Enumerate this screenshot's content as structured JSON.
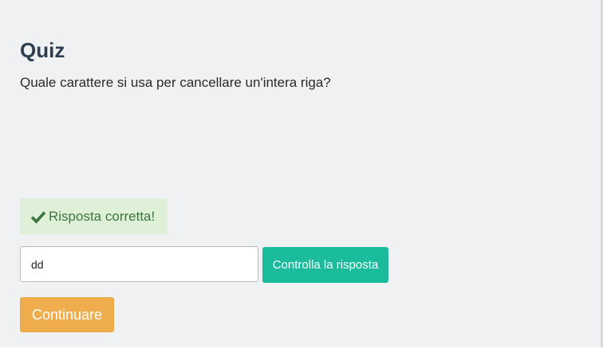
{
  "quiz": {
    "title": "Quiz",
    "question": "Quale carattere si usa per cancellare un'intera riga?"
  },
  "feedback": {
    "icon": "check-icon",
    "text": "Risposta corretta!",
    "color": "#3c763d",
    "background": "#dff0d8"
  },
  "answer": {
    "value": "dd",
    "placeholder": ""
  },
  "buttons": {
    "check_label": "Controlla la risposta",
    "check_color": "#1abc9c",
    "continue_label": "Continuare",
    "continue_color": "#f0ad4e"
  }
}
